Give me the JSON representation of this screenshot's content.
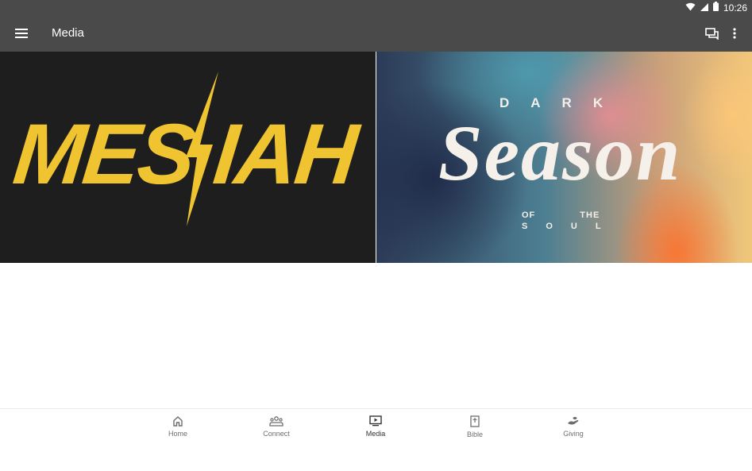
{
  "status_bar": {
    "time": "10:26"
  },
  "app_bar": {
    "title": "Media"
  },
  "media_cards": [
    {
      "title": "MESSIAH",
      "display": "MES IAH"
    },
    {
      "title_top": "DARK",
      "title_main": "Season",
      "subtitle_words": [
        "OF",
        "THE"
      ],
      "subtitle_last": "SOUL"
    }
  ],
  "bottom_nav": {
    "items": [
      {
        "label": "Home",
        "icon": "home-icon"
      },
      {
        "label": "Connect",
        "icon": "people-icon"
      },
      {
        "label": "Media",
        "icon": "tv-play-icon",
        "active": true
      },
      {
        "label": "Bible",
        "icon": "bible-icon"
      },
      {
        "label": "Giving",
        "icon": "giving-hand-icon"
      }
    ]
  },
  "colors": {
    "app_bar": "#4a4a4a",
    "messiah_yellow": "#f0c430",
    "card_dark_bg": "#1e1e1e"
  }
}
